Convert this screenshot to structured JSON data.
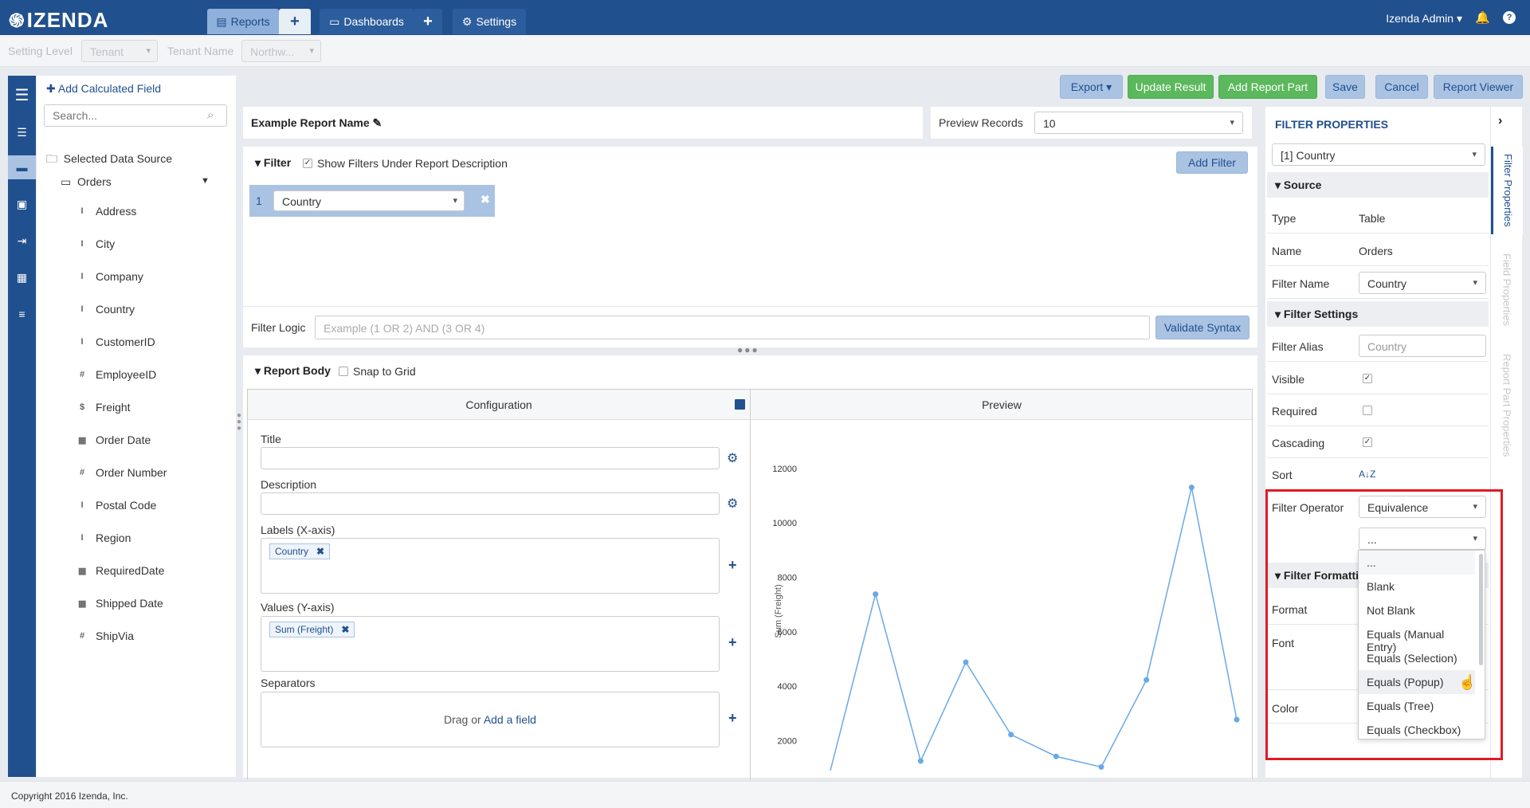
{
  "app": {
    "logo": "IZENDA",
    "user": "Izenda Admin"
  },
  "nav": {
    "reports": "Reports",
    "add": "+",
    "dashboards": "Dashboards",
    "add2": "+",
    "settings": "Settings"
  },
  "settings_bar": {
    "setting_level_label": "Setting Level",
    "setting_level_value": "Tenant",
    "tenant_name_label": "Tenant Name",
    "tenant_name_value": "Northw..."
  },
  "fields_panel": {
    "add_calculated": "Add Calculated Field",
    "search_placeholder": "Search...",
    "data_source_label": "Selected Data Source",
    "table": "Orders",
    "fields": [
      {
        "type": "T",
        "name": "Address"
      },
      {
        "type": "T",
        "name": "City"
      },
      {
        "type": "T",
        "name": "Company"
      },
      {
        "type": "T",
        "name": "Country"
      },
      {
        "type": "T",
        "name": "CustomerID"
      },
      {
        "type": "#",
        "name": "EmployeeID"
      },
      {
        "type": "$",
        "name": "Freight"
      },
      {
        "type": "cal",
        "name": "Order Date"
      },
      {
        "type": "#",
        "name": "Order Number"
      },
      {
        "type": "T",
        "name": "Postal Code"
      },
      {
        "type": "T",
        "name": "Region"
      },
      {
        "type": "cal",
        "name": "RequiredDate"
      },
      {
        "type": "cal",
        "name": "Shipped Date"
      },
      {
        "type": "#",
        "name": "ShipVia"
      }
    ]
  },
  "toolbar": {
    "export": "Export",
    "update_result": "Update Result",
    "add_report_part": "Add Report Part",
    "save": "Save",
    "cancel": "Cancel",
    "report_viewer": "Report Viewer"
  },
  "report": {
    "name": "Example Report Name",
    "preview_label": "Preview Records",
    "preview_value": "10"
  },
  "filter": {
    "header": "Filter",
    "show_under": "Show Filters Under Report Description",
    "add_filter": "Add Filter",
    "item_number": "1",
    "item_field": "Country",
    "logic_label": "Filter Logic",
    "logic_placeholder": "Example (1 OR 2) AND (3 OR 4)",
    "validate": "Validate Syntax"
  },
  "report_body": {
    "header": "Report Body",
    "snap": "Snap to Grid",
    "config_title": "Configuration",
    "preview_title": "Preview",
    "title_label": "Title",
    "description_label": "Description",
    "labels_label": "Labels (X-axis)",
    "labels_tag": "Country",
    "values_label": "Values (Y-axis)",
    "values_tag": "Sum (Freight)",
    "separators_label": "Separators",
    "drag_text": "Drag or",
    "add_field_link": "Add a field"
  },
  "chart_data": {
    "type": "line",
    "ylabel": "Sum (Freight)",
    "yticks": [
      2000,
      4000,
      6000,
      8000,
      10000,
      12000
    ],
    "ylim": [
      900,
      12900
    ],
    "values": [
      900,
      7380,
      1250,
      4880,
      2220,
      1420,
      1030,
      4230,
      11300,
      2770
    ],
    "color": "#6aa8e6"
  },
  "filter_props": {
    "title": "FILTER PROPERTIES",
    "selected": "[1] Country",
    "source_section": "Source",
    "type_label": "Type",
    "type_value": "Table",
    "name_label": "Name",
    "name_value": "Orders",
    "filter_name_label": "Filter Name",
    "filter_name_value": "Country",
    "settings_section": "Filter Settings",
    "alias_label": "Filter Alias",
    "alias_placeholder": "Country",
    "visible_label": "Visible",
    "required_label": "Required",
    "cascading_label": "Cascading",
    "sort_label": "Sort",
    "sort_icon": "A↓Z",
    "operator_label": "Filter Operator",
    "operator_value": "Equivalence",
    "operator_sub_value": "...",
    "formatting_section": "Filter Formatti",
    "format_label": "Format",
    "font_label": "Font",
    "color_label": "Color"
  },
  "operator_options": [
    "...",
    "Blank",
    "Not Blank",
    "Equals (Manual Entry)",
    "Equals (Selection)",
    "Equals (Popup)",
    "Equals (Tree)",
    "Equals (Checkbox)"
  ],
  "side_tabs": {
    "filter": "Filter Properties",
    "field": "Field Properties",
    "part": "Report Part Properties"
  },
  "footer": "Copyright 2016 Izenda, Inc."
}
